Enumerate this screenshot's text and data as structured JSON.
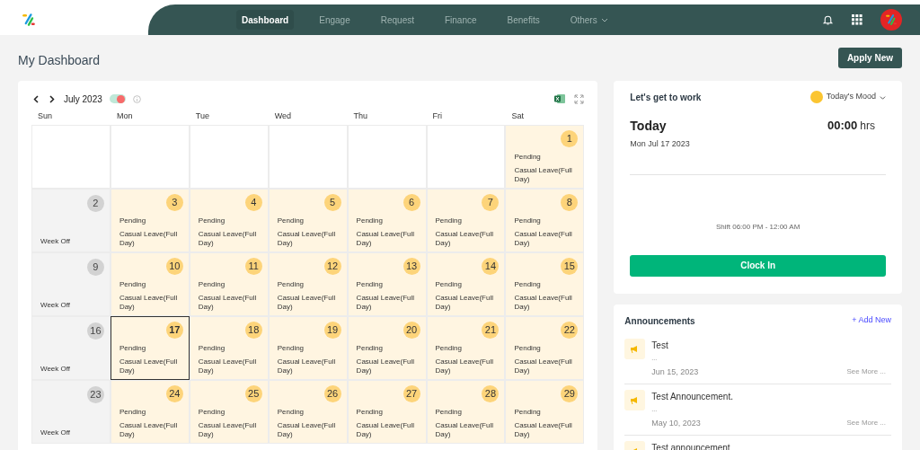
{
  "nav": {
    "items": [
      {
        "label": "Dashboard",
        "selected": true,
        "dropdown": false
      },
      {
        "label": "Engage",
        "selected": false,
        "dropdown": false
      },
      {
        "label": "Request",
        "selected": false,
        "dropdown": false
      },
      {
        "label": "Finance",
        "selected": false,
        "dropdown": false
      },
      {
        "label": "Benefits",
        "selected": false,
        "dropdown": false
      },
      {
        "label": "Others",
        "selected": false,
        "dropdown": true
      }
    ]
  },
  "page": {
    "title": "My Dashboard",
    "apply_button": "Apply New"
  },
  "calendar": {
    "month": "July 2023",
    "toggle": {
      "on": true
    },
    "weekdays": [
      "Sun",
      "Mon",
      "Tue",
      "Wed",
      "Thu",
      "Fri",
      "Sat"
    ],
    "weeks": [
      [
        {
          "kind": "empty"
        },
        {
          "kind": "empty"
        },
        {
          "kind": "empty"
        },
        {
          "kind": "empty"
        },
        {
          "kind": "empty"
        },
        {
          "kind": "empty"
        },
        {
          "kind": "leave",
          "day": "1",
          "status": "Pending",
          "leave": "Casual Leave(Full Day)",
          "selected": false
        }
      ],
      [
        {
          "kind": "weekoff",
          "day": "2",
          "note": "Week Off"
        },
        {
          "kind": "leave",
          "day": "3",
          "status": "Pending",
          "leave": "Casual Leave(Full Day)",
          "selected": false
        },
        {
          "kind": "leave",
          "day": "4",
          "status": "Pending",
          "leave": "Casual Leave(Full Day)",
          "selected": false
        },
        {
          "kind": "leave",
          "day": "5",
          "status": "Pending",
          "leave": "Casual Leave(Full Day)",
          "selected": false
        },
        {
          "kind": "leave",
          "day": "6",
          "status": "Pending",
          "leave": "Casual Leave(Full Day)",
          "selected": false
        },
        {
          "kind": "leave",
          "day": "7",
          "status": "Pending",
          "leave": "Casual Leave(Full Day)",
          "selected": false
        },
        {
          "kind": "leave",
          "day": "8",
          "status": "Pending",
          "leave": "Casual Leave(Full Day)",
          "selected": false
        }
      ],
      [
        {
          "kind": "weekoff",
          "day": "9",
          "note": "Week Off"
        },
        {
          "kind": "leave",
          "day": "10",
          "status": "Pending",
          "leave": "Casual Leave(Full Day)",
          "selected": false
        },
        {
          "kind": "leave",
          "day": "11",
          "status": "Pending",
          "leave": "Casual Leave(Full Day)",
          "selected": false
        },
        {
          "kind": "leave",
          "day": "12",
          "status": "Pending",
          "leave": "Casual Leave(Full Day)",
          "selected": false
        },
        {
          "kind": "leave",
          "day": "13",
          "status": "Pending",
          "leave": "Casual Leave(Full Day)",
          "selected": false
        },
        {
          "kind": "leave",
          "day": "14",
          "status": "Pending",
          "leave": "Casual Leave(Full Day)",
          "selected": false
        },
        {
          "kind": "leave",
          "day": "15",
          "status": "Pending",
          "leave": "Casual Leave(Full Day)",
          "selected": false
        }
      ],
      [
        {
          "kind": "weekoff",
          "day": "16",
          "note": "Week Off"
        },
        {
          "kind": "leave",
          "day": "17",
          "status": "Pending",
          "leave": "Casual Leave(Full Day)",
          "selected": true
        },
        {
          "kind": "leave",
          "day": "18",
          "status": "Pending",
          "leave": "Casual Leave(Full Day)",
          "selected": false
        },
        {
          "kind": "leave",
          "day": "19",
          "status": "Pending",
          "leave": "Casual Leave(Full Day)",
          "selected": false
        },
        {
          "kind": "leave",
          "day": "20",
          "status": "Pending",
          "leave": "Casual Leave(Full Day)",
          "selected": false
        },
        {
          "kind": "leave",
          "day": "21",
          "status": "Pending",
          "leave": "Casual Leave(Full Day)",
          "selected": false
        },
        {
          "kind": "leave",
          "day": "22",
          "status": "Pending",
          "leave": "Casual Leave(Full Day)",
          "selected": false
        }
      ],
      [
        {
          "kind": "weekoff",
          "day": "23",
          "note": "Week Off"
        },
        {
          "kind": "leave",
          "day": "24",
          "status": "Pending",
          "leave": "Casual Leave(Full Day)",
          "selected": false
        },
        {
          "kind": "leave",
          "day": "25",
          "status": "Pending",
          "leave": "Casual Leave(Full Day)",
          "selected": false
        },
        {
          "kind": "leave",
          "day": "26",
          "status": "Pending",
          "leave": "Casual Leave(Full Day)",
          "selected": false
        },
        {
          "kind": "leave",
          "day": "27",
          "status": "Pending",
          "leave": "Casual Leave(Full Day)",
          "selected": false
        },
        {
          "kind": "leave",
          "day": "28",
          "status": "Pending",
          "leave": "Casual Leave(Full Day)",
          "selected": false
        },
        {
          "kind": "leave",
          "day": "29",
          "status": "Pending",
          "leave": "Casual Leave(Full Day)",
          "selected": false
        }
      ]
    ]
  },
  "work": {
    "title": "Let's get to work",
    "mood": "Today's Mood",
    "today": "Today",
    "date": "Mon Jul 17 2023",
    "hours": "00:00",
    "hours_unit": "hrs",
    "shift": "Shift 06:00 PM - 12:00 AM",
    "button": "Clock In"
  },
  "announcements": {
    "title": "Announcements",
    "add": "+ Add New",
    "items": [
      {
        "title": "Test",
        "excerpt": "...",
        "date": "Jun 15, 2023",
        "more": "See More ..."
      },
      {
        "title": "Test Announcement.",
        "excerpt": "...",
        "date": "May 10, 2023",
        "more": "See More ..."
      },
      {
        "title": "Test announcement"
      }
    ]
  }
}
